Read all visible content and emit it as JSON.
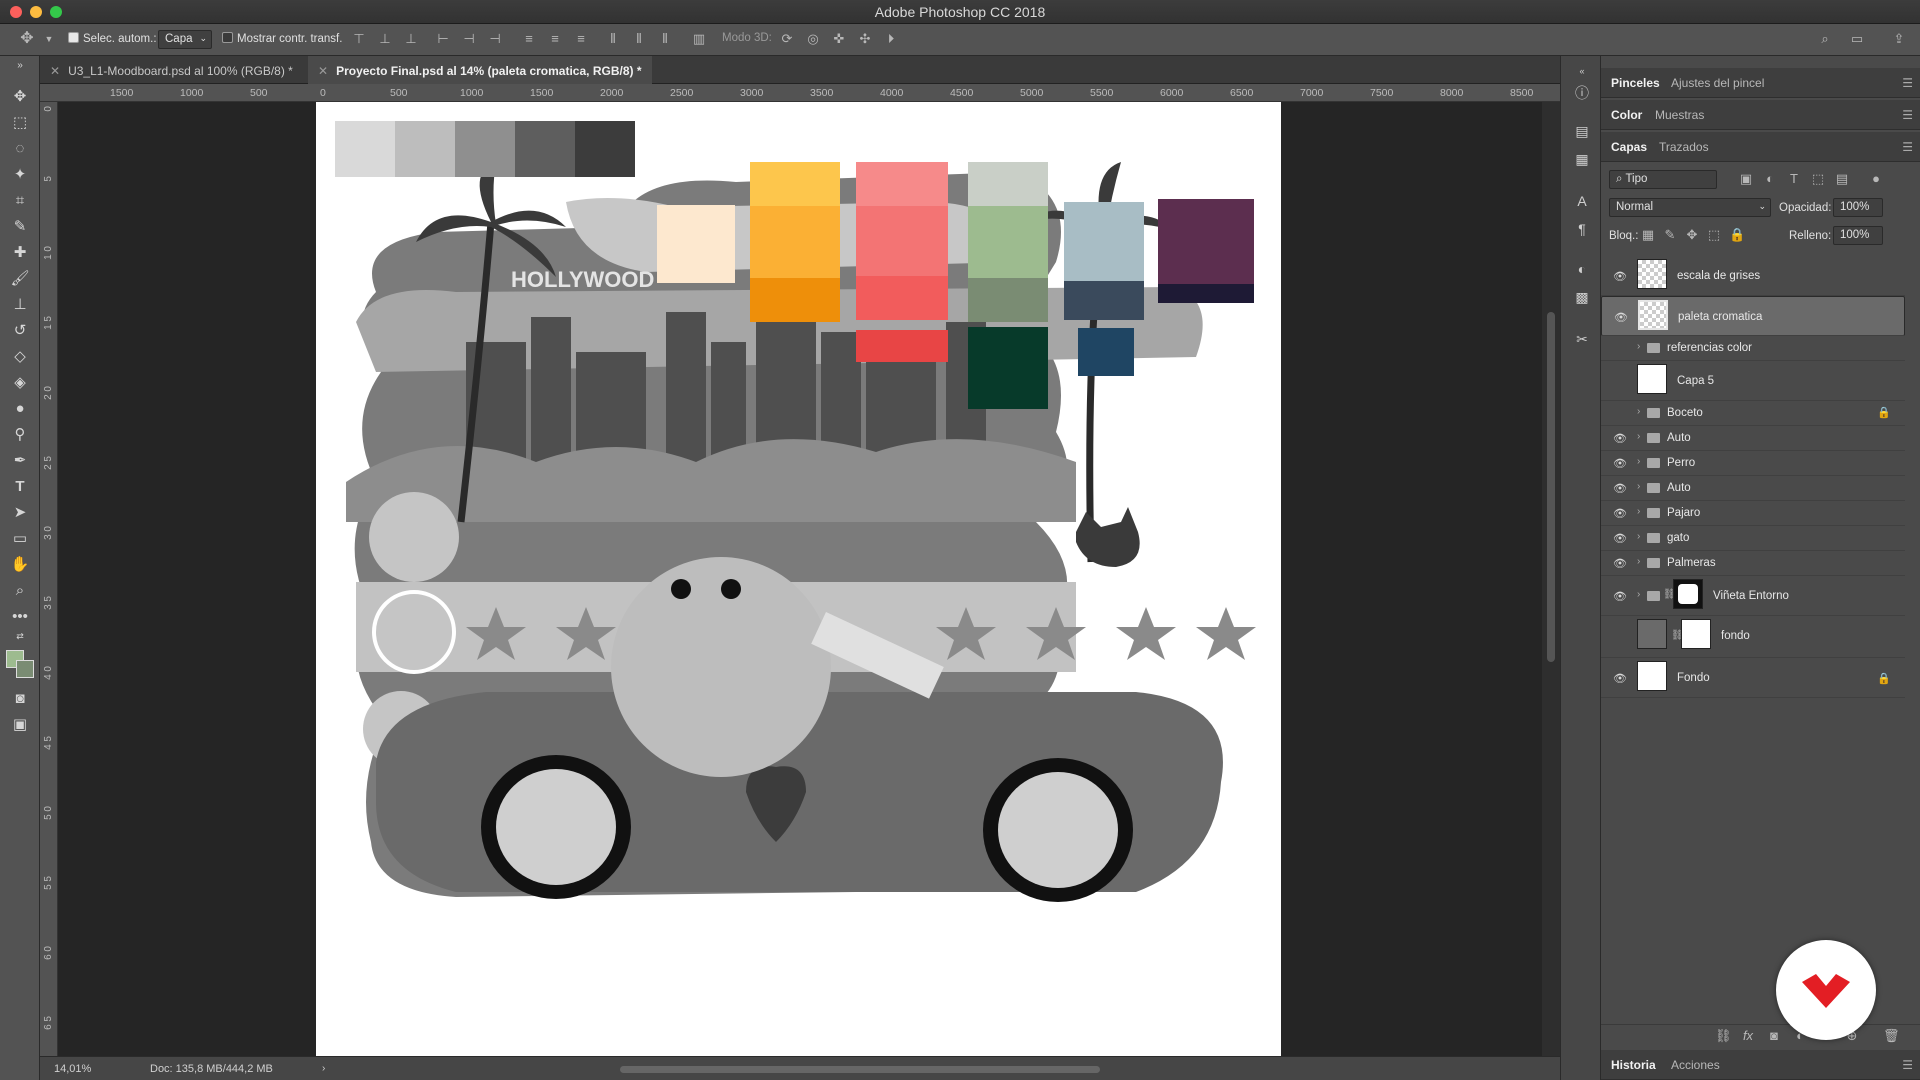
{
  "app": {
    "title": "Adobe Photoshop CC 2018"
  },
  "options_bar": {
    "auto_select_label": "Selec. autom.:",
    "auto_select_value": "Capa",
    "show_transform_label": "Mostrar contr. transf.",
    "mode_3d_label": "Modo 3D:"
  },
  "doc_tabs": [
    {
      "label": "U3_L1-Moodboard.psd al 100% (RGB/8) *"
    },
    {
      "label": "Proyecto Final.psd al 14% (paleta cromatica, RGB/8) *"
    }
  ],
  "ruler": {
    "h": [
      "1500",
      "1000",
      "500",
      "0",
      "500",
      "1000",
      "1500",
      "2000",
      "2500",
      "3000",
      "3500",
      "4000",
      "4500",
      "5000",
      "5500",
      "6000",
      "6500",
      "7000",
      "7500",
      "8000",
      "8500"
    ],
    "v": [
      "0",
      "5",
      "1 0",
      "1 5",
      "2 0",
      "2 5",
      "3 0",
      "3 5",
      "4 0",
      "4 5",
      "5 0",
      "5 5",
      "6 0",
      "6 5"
    ]
  },
  "canvas_art": {
    "sign_text": "HOLLYWOOD"
  },
  "status": {
    "zoom": "14,01%",
    "doc": "Doc: 135,8 MB/444,2 MB"
  },
  "panels": {
    "brushes": {
      "tab1": "Pinceles",
      "tab2": "Ajustes del pincel"
    },
    "color": {
      "tab1": "Color",
      "tab2": "Muestras"
    },
    "layers": {
      "tab1": "Capas",
      "tab2": "Trazados",
      "filter_value": "Tipo",
      "blend_mode": "Normal",
      "opacity_label": "Opacidad:",
      "opacity_value": "100%",
      "lock_label": "Bloq.:",
      "fill_label": "Relleno:",
      "fill_value": "100%",
      "items": [
        {
          "name": "escala de grises",
          "visible": true,
          "type": "layer"
        },
        {
          "name": "paleta cromatica",
          "visible": true,
          "type": "layer",
          "selected": true
        },
        {
          "name": "referencias color",
          "visible": false,
          "type": "group"
        },
        {
          "name": "Capa 5",
          "visible": false,
          "type": "layer"
        },
        {
          "name": "Boceto",
          "visible": false,
          "type": "group",
          "locked": true
        },
        {
          "name": "Auto",
          "visible": true,
          "type": "group"
        },
        {
          "name": "Perro",
          "visible": true,
          "type": "group"
        },
        {
          "name": "Auto",
          "visible": true,
          "type": "group"
        },
        {
          "name": "Pajaro",
          "visible": true,
          "type": "group"
        },
        {
          "name": "gato",
          "visible": true,
          "type": "group"
        },
        {
          "name": "Palmeras",
          "visible": true,
          "type": "group"
        },
        {
          "name": "Viñeta Entorno",
          "visible": true,
          "type": "group-mask"
        },
        {
          "name": "fondo",
          "visible": false,
          "type": "layer-mask"
        },
        {
          "name": "Fondo",
          "visible": true,
          "type": "layer",
          "locked": true
        }
      ]
    },
    "history": {
      "tab1": "Historia",
      "tab2": "Acciones"
    }
  },
  "swatches": {
    "gray_strip": [
      "#d9d9d9",
      "#bdbdbd",
      "#8f8f8f",
      "#5e5e5e",
      "#3c3c3c"
    ],
    "cream": "#fde8cf",
    "yellow": [
      "#fdc64c",
      "#fbb034",
      "#ee8f0a"
    ],
    "pink": [
      "#f68a8a",
      "#f37474",
      "#f25c5c"
    ],
    "red": "#e84545",
    "sage": [
      "#c9cfc7",
      "#9dbb8f",
      "#7a8c73"
    ],
    "darkgreen": "#073a2a",
    "bluegray": [
      "#a8bdc5",
      "#3a4a5c"
    ],
    "navy": "#1f4563",
    "plum": [
      "#5c2e4f",
      "#1e1a35"
    ]
  }
}
